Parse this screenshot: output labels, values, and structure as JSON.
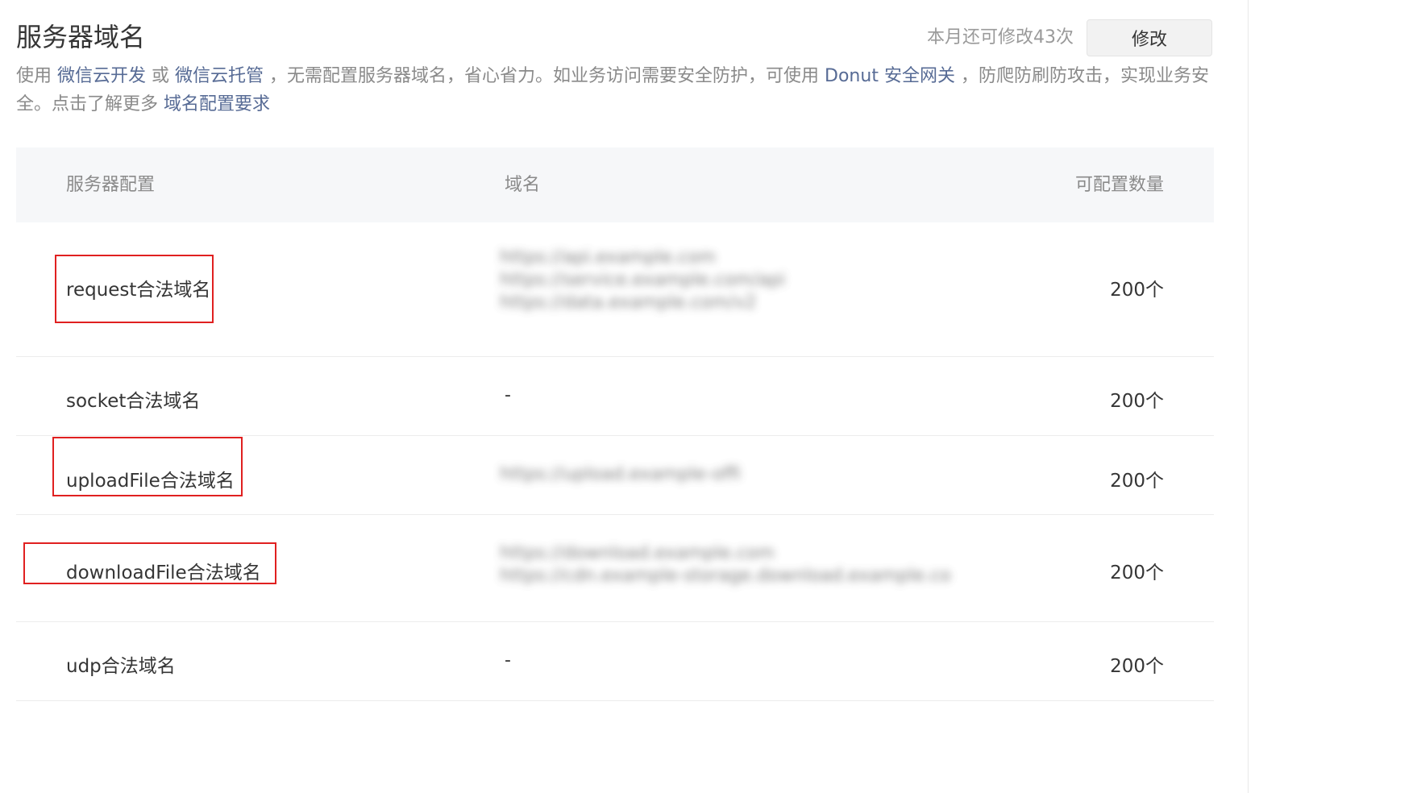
{
  "header": {
    "title": "服务器域名",
    "quota_text": "本月还可修改43次",
    "edit_button": "修改"
  },
  "description": {
    "t1": "使用 ",
    "link1": "微信云开发",
    "t2": " 或 ",
    "link2": "微信云托管",
    "t3": " ，无需配置服务器域名，省心省力。如业务访问需要安全防护，可使用 ",
    "link3": "Donut 安全网关",
    "t4": " ，防爬防刷防攻击，实现业务安全。点击了解更多 ",
    "link4": "域名配置要求"
  },
  "table": {
    "headers": [
      "服务器配置",
      "域名",
      "可配置数量"
    ],
    "rows": [
      {
        "name": "request合法域名",
        "domains": [
          "https://api.example.com",
          "https://service.example.com/api",
          "https://data.example.com/v2"
        ],
        "count": "200个"
      },
      {
        "name": "socket合法域名",
        "domain_text": "-",
        "count": "200个"
      },
      {
        "name": "uploadFile合法域名",
        "domains": [
          "https://upload.example-official.com"
        ],
        "count": "200个"
      },
      {
        "name": "downloadFile合法域名",
        "domains": [
          "https://download.example.com",
          "https://cdn.example-storage.download.example.com"
        ],
        "count": "200个"
      },
      {
        "name": "udp合法域名",
        "domain_text": "-",
        "count": "200个"
      }
    ]
  }
}
